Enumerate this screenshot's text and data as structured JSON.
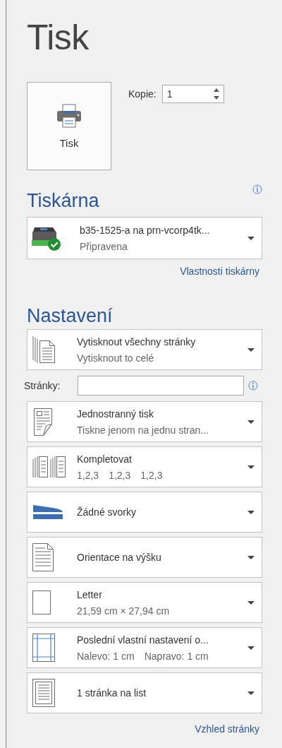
{
  "title": "Tisk",
  "print_button": {
    "label": "Tisk"
  },
  "copies": {
    "label": "Kopie:",
    "value": "1"
  },
  "printer_section": {
    "heading": "Tiskárna",
    "device": {
      "name": "b35-1525-a na prn-vcorp4tk...",
      "status": "Připravena"
    },
    "link": "Vlastnosti tiskárny"
  },
  "settings_section": {
    "heading": "Nastavení",
    "items": [
      {
        "kind": "pages",
        "title": "Vytisknout všechny stránky",
        "subtitle": [
          "Vytisknout to celé"
        ]
      },
      {
        "kind": "pagefield",
        "label": "Stránky:"
      },
      {
        "kind": "sides",
        "title": "Jednostranný tisk",
        "subtitle": [
          "Tiskne jenom na jednu stran..."
        ]
      },
      {
        "kind": "collate",
        "title": "Kompletovat",
        "subtitle": [
          "1,2,3",
          "1,2,3",
          "1,2,3"
        ]
      },
      {
        "kind": "staple",
        "title": "Žádné svorky"
      },
      {
        "kind": "orientation",
        "title": "Orientace na výšku"
      },
      {
        "kind": "paper",
        "title": "Letter",
        "subtitle": [
          "21,59 cm × 27,94 cm"
        ]
      },
      {
        "kind": "margins",
        "title": "Poslední vlastní nastavení o...",
        "subtitle": [
          "Nalevo:  1 cm",
          "Napravo:  1 cm"
        ]
      },
      {
        "kind": "persheet",
        "title": "1 stránka na list"
      }
    ],
    "link": "Vzhled stránky"
  }
}
